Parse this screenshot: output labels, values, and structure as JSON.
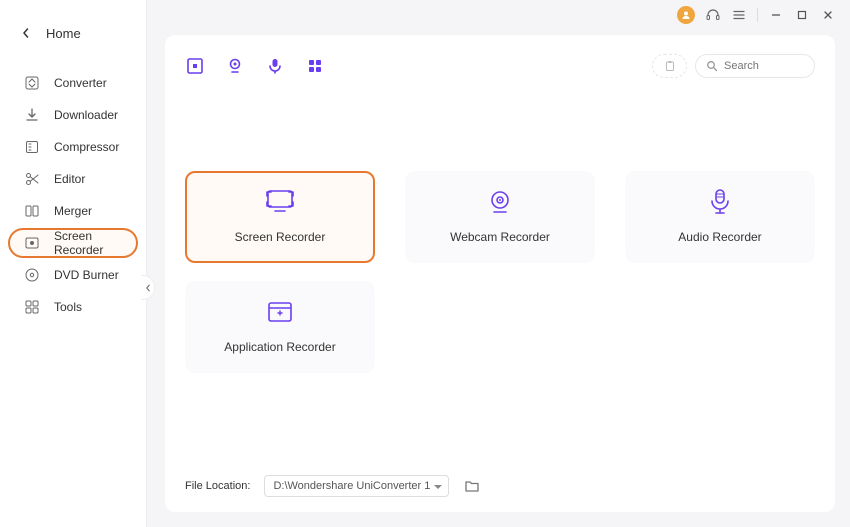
{
  "sidebar": {
    "home_label": "Home",
    "items": [
      {
        "label": "Converter",
        "icon": "converter"
      },
      {
        "label": "Downloader",
        "icon": "download"
      },
      {
        "label": "Compressor",
        "icon": "compress"
      },
      {
        "label": "Editor",
        "icon": "scissors"
      },
      {
        "label": "Merger",
        "icon": "merge"
      },
      {
        "label": "Screen Recorder",
        "icon": "record",
        "selected": true
      },
      {
        "label": "DVD Burner",
        "icon": "disc"
      },
      {
        "label": "Tools",
        "icon": "grid"
      }
    ]
  },
  "titlebar": {},
  "toolbar": {
    "search_placeholder": "Search"
  },
  "cards": [
    {
      "label": "Screen Recorder",
      "highlighted": true
    },
    {
      "label": "Webcam Recorder",
      "highlighted": false
    },
    {
      "label": "Audio Recorder",
      "highlighted": false
    },
    {
      "label": "Application Recorder",
      "highlighted": false
    }
  ],
  "footer": {
    "file_location_label": "File Location:",
    "file_location_value": "D:\\Wondershare UniConverter 1"
  }
}
